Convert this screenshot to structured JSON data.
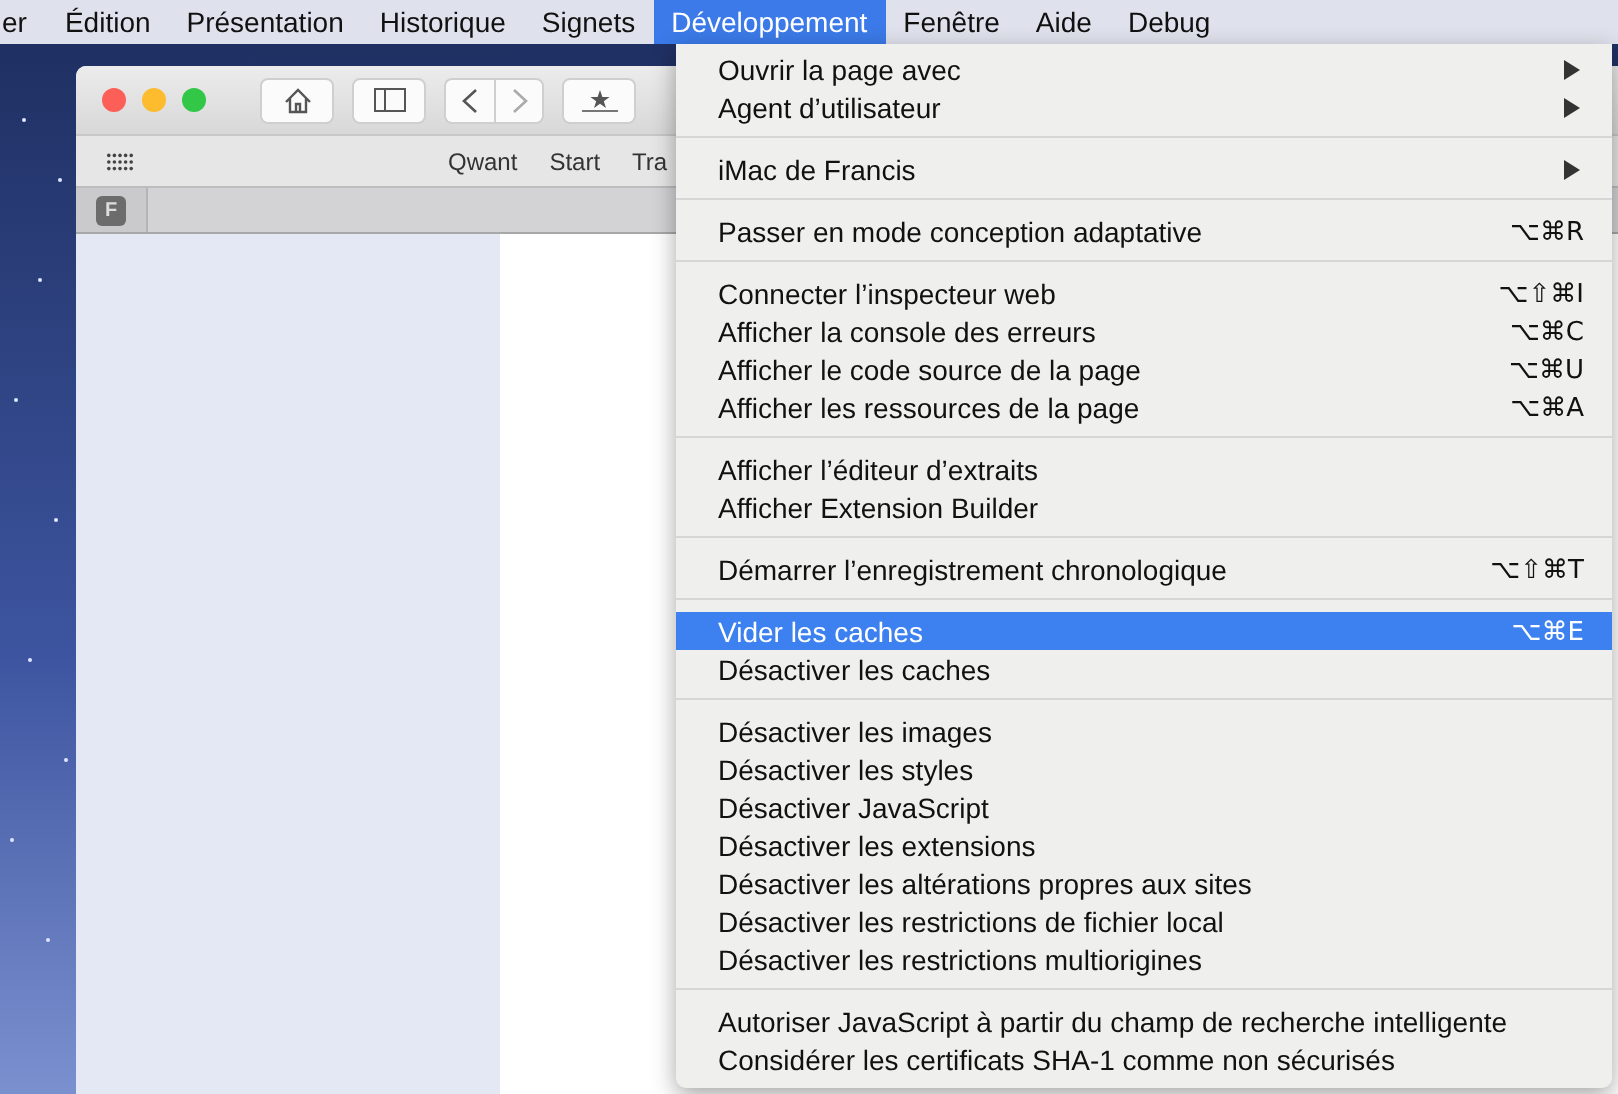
{
  "menu_bar": [
    {
      "label": "er",
      "selected": false
    },
    {
      "label": "Édition",
      "selected": false
    },
    {
      "label": "Présentation",
      "selected": false
    },
    {
      "label": "Historique",
      "selected": false
    },
    {
      "label": "Signets",
      "selected": false
    },
    {
      "label": "Développement",
      "selected": true
    },
    {
      "label": "Fenêtre",
      "selected": false
    },
    {
      "label": "Aide",
      "selected": false
    },
    {
      "label": "Debug",
      "selected": false
    }
  ],
  "browser": {
    "favorites": [
      "Qwant",
      "Start",
      "Tra"
    ],
    "tab_icon": "F"
  },
  "menu": [
    {
      "kind": "item",
      "label": "Ouvrir la page avec",
      "submenu": true,
      "selected": false
    },
    {
      "kind": "item",
      "label": "Agent d’utilisateur",
      "submenu": true,
      "selected": false
    },
    {
      "kind": "separator"
    },
    {
      "kind": "item",
      "label": "iMac de Francis",
      "submenu": true,
      "selected": false
    },
    {
      "kind": "separator"
    },
    {
      "kind": "item",
      "label": "Passer en mode conception adaptative",
      "shortcut": "⌥⌘R",
      "selected": false
    },
    {
      "kind": "separator"
    },
    {
      "kind": "item",
      "label": "Connecter l’inspecteur web",
      "shortcut": "⌥⇧⌘I",
      "selected": false
    },
    {
      "kind": "item",
      "label": "Afficher la console des erreurs",
      "shortcut": "⌥⌘C",
      "selected": false
    },
    {
      "kind": "item",
      "label": "Afficher le code source de la page",
      "shortcut": "⌥⌘U",
      "selected": false
    },
    {
      "kind": "item",
      "label": "Afficher les ressources de la page",
      "shortcut": "⌥⌘A",
      "selected": false
    },
    {
      "kind": "separator"
    },
    {
      "kind": "item",
      "label": "Afficher l’éditeur d’extraits",
      "selected": false
    },
    {
      "kind": "item",
      "label": "Afficher Extension Builder",
      "selected": false
    },
    {
      "kind": "separator"
    },
    {
      "kind": "item",
      "label": "Démarrer l’enregistrement chronologique",
      "shortcut": "⌥⇧⌘T",
      "selected": false
    },
    {
      "kind": "separator"
    },
    {
      "kind": "item",
      "label": "Vider les caches",
      "shortcut": "⌥⌘E",
      "selected": true
    },
    {
      "kind": "item",
      "label": "Désactiver les caches",
      "selected": false
    },
    {
      "kind": "separator"
    },
    {
      "kind": "item",
      "label": "Désactiver les images",
      "selected": false
    },
    {
      "kind": "item",
      "label": "Désactiver les styles",
      "selected": false
    },
    {
      "kind": "item",
      "label": "Désactiver JavaScript",
      "selected": false
    },
    {
      "kind": "item",
      "label": "Désactiver les extensions",
      "selected": false
    },
    {
      "kind": "item",
      "label": "Désactiver les altérations propres aux sites",
      "selected": false
    },
    {
      "kind": "item",
      "label": "Désactiver les restrictions de fichier local",
      "selected": false
    },
    {
      "kind": "item",
      "label": "Désactiver les restrictions multiorigines",
      "selected": false
    },
    {
      "kind": "separator"
    },
    {
      "kind": "item",
      "label": "Autoriser JavaScript à partir du champ de recherche intelligente",
      "selected": false
    },
    {
      "kind": "item",
      "label": "Considérer les certificats SHA-1 comme non sécurisés",
      "selected": false
    }
  ]
}
